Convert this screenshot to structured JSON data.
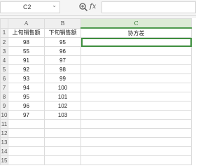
{
  "formula_bar": {
    "cell_ref": "C2",
    "dropdown_glyph": "⌄",
    "fx_label": "fx",
    "formula": ""
  },
  "sheet": {
    "columns": [
      "A",
      "B",
      "C"
    ],
    "headers": [
      "上旬销售额",
      "下旬销售额",
      "协方差"
    ],
    "row_numbers": [
      "1",
      "2",
      "3",
      "4",
      "5",
      "6",
      "7",
      "8",
      "9",
      "10",
      "11",
      "12",
      "13",
      "14",
      "15"
    ],
    "rows": [
      [
        "98",
        "95",
        ""
      ],
      [
        "55",
        "96",
        ""
      ],
      [
        "91",
        "97",
        ""
      ],
      [
        "92",
        "98",
        ""
      ],
      [
        "93",
        "99",
        ""
      ],
      [
        "94",
        "100",
        ""
      ],
      [
        "95",
        "101",
        ""
      ],
      [
        "96",
        "102",
        ""
      ],
      [
        "97",
        "103",
        ""
      ]
    ],
    "selected_cell": "C2"
  }
}
